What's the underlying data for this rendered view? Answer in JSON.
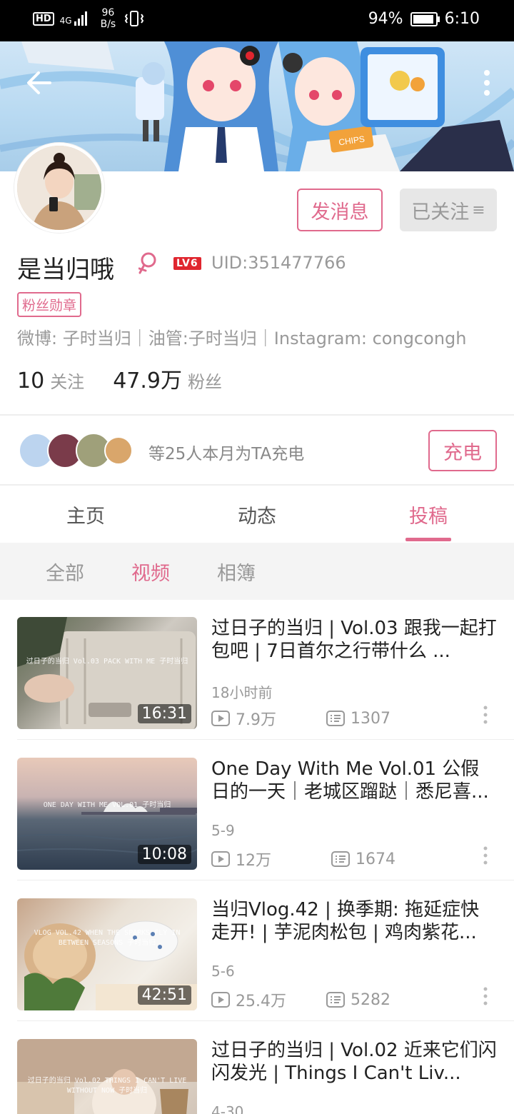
{
  "status_bar": {
    "hd": "HD",
    "network": "4G",
    "speed_value": "96",
    "speed_unit": "B/s",
    "battery_percent": "94%",
    "battery_level": 0.94,
    "time": "6:10"
  },
  "header": {
    "back_icon": "arrow-left-icon",
    "more_icon": "more-vertical-icon",
    "banner_text": "CHIPS"
  },
  "profile": {
    "name": "是当归哦",
    "gender_icon": "female-icon",
    "level": "LV6",
    "uid": "UID:351477766",
    "fan_medal": "粉丝勋章",
    "bio": "微博: 子时当归｜油管:子时当归｜Instagram: congcongh",
    "following_count": "10",
    "following_label": "关注",
    "followers_count": "47.9万",
    "followers_label": "粉丝",
    "message_button": "发消息",
    "followed_button": "已关注",
    "followed_icon": "≡"
  },
  "charge": {
    "text": "等25人本月为TA充电",
    "button": "充电"
  },
  "tabs": [
    {
      "label": "主页",
      "active": false
    },
    {
      "label": "动态",
      "active": false
    },
    {
      "label": "投稿",
      "active": true
    }
  ],
  "subtabs": [
    {
      "label": "全部",
      "active": false
    },
    {
      "label": "视频",
      "active": true
    },
    {
      "label": "相簿",
      "active": false
    }
  ],
  "videos": [
    {
      "title": "过日子的当归 | Vol.03 跟我一起打包吧 | 7日首尔之行带什么 ...",
      "duration": "16:31",
      "date": "18小时前",
      "plays": "7.9万",
      "danmaku": "1307",
      "thumb_text": "过日子的当归 Vol.03 PACK WITH ME 子时当归"
    },
    {
      "title": "One Day With Me Vol.01 公假日的一天｜老城区蹓跶｜悉尼喜...",
      "duration": "10:08",
      "date": "5-9",
      "plays": "12万",
      "danmaku": "1674",
      "thumb_text": "ONE DAY WITH ME VOL.01 子时当归"
    },
    {
      "title": "当归Vlog.42 | 换季期: 拖延症快走开! | 芋泥肉松包 | 鸡肉紫花...",
      "duration": "42:51",
      "date": "5-6",
      "plays": "25.4万",
      "danmaku": "5282",
      "thumb_text": "VLOG VOL.42 WHEN THE SPARKS FLY IN BETWEEN SEASONS 子时当归"
    },
    {
      "title": "过日子的当归 | Vol.02 近来它们闪闪发光 | Things I Can't Liv...",
      "duration": "",
      "date": "4-30",
      "plays": "",
      "danmaku": "",
      "thumb_text": "过日子的当归 Vol.02 THINGS I CAN'T LIVE WITHOUT NOW 子时当归"
    }
  ],
  "icons": {
    "play": "play-icon",
    "danmaku": "danmaku-icon",
    "more": "more-vertical-icon"
  },
  "colors": {
    "accent": "#e06a8d",
    "level_badge": "#e0262f"
  }
}
